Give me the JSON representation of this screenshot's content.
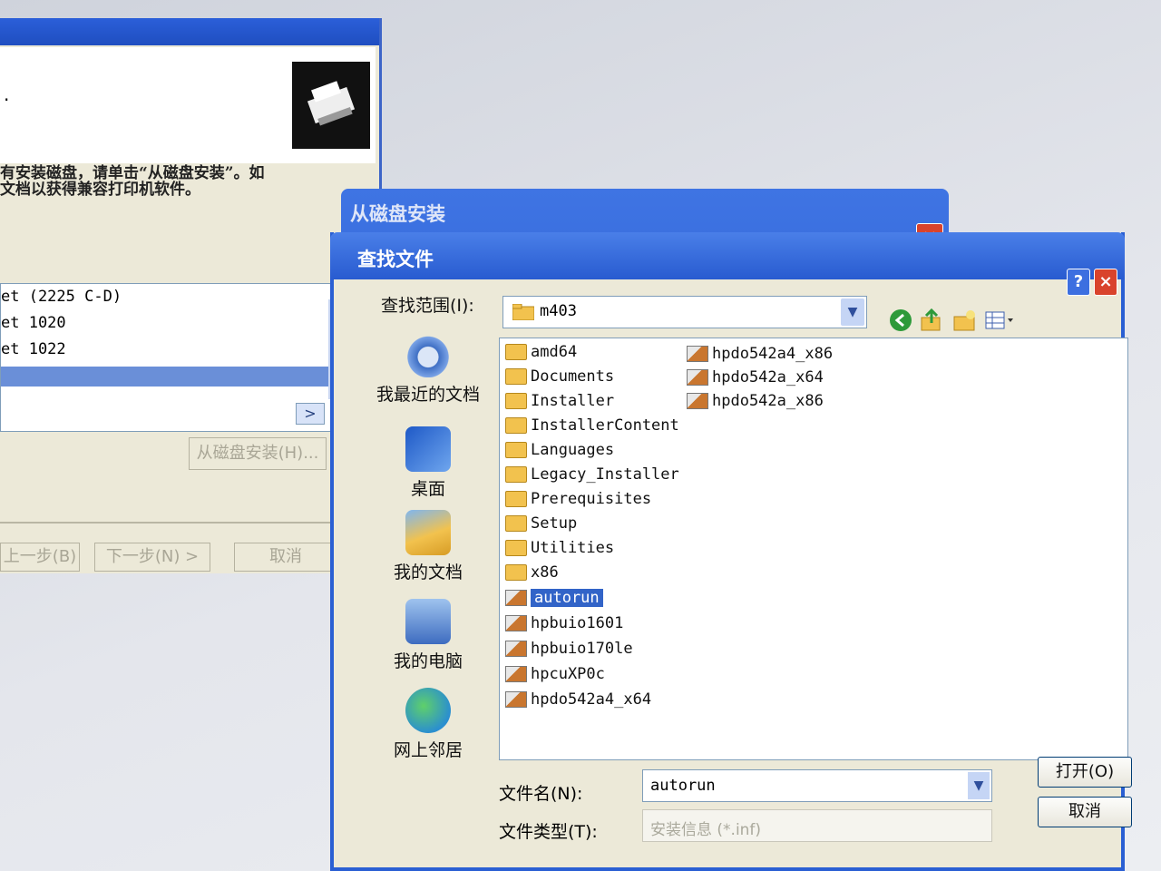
{
  "background_wizard": {
    "info_line1": "有安装磁盘，请单击“从磁盘安装”。如",
    "info_line2": "文档以获得兼容打印机软件。",
    "printers": [
      "et (2225 C-D)",
      "et 1020",
      "et 1022"
    ],
    "have_disk_button": "从磁盘安装(H)...",
    "back_button": "上一步(B)",
    "next_button": "下一步(N) >",
    "cancel_button": "取消"
  },
  "install_from_disk_dialog": {
    "title": "从磁盘安装",
    "close": "×"
  },
  "find_file_dialog": {
    "title": "查找文件",
    "help": "?",
    "close": "×",
    "look_in_label": "查找范围(I):",
    "look_in_value": "m403",
    "places": [
      {
        "label": "我最近的文档",
        "icon": "recent-documents-icon"
      },
      {
        "label": "桌面",
        "icon": "desktop-icon"
      },
      {
        "label": "我的文档",
        "icon": "my-documents-icon"
      },
      {
        "label": "我的电脑",
        "icon": "my-computer-icon"
      },
      {
        "label": "网上邻居",
        "icon": "network-places-icon"
      }
    ],
    "files": [
      {
        "name": "amd64",
        "type": "folder"
      },
      {
        "name": "Documents",
        "type": "folder"
      },
      {
        "name": "Installer",
        "type": "folder"
      },
      {
        "name": "InstallerContent",
        "type": "folder"
      },
      {
        "name": "Languages",
        "type": "folder"
      },
      {
        "name": "Legacy_Installer",
        "type": "folder"
      },
      {
        "name": "Prerequisites",
        "type": "folder"
      },
      {
        "name": "Setup",
        "type": "folder"
      },
      {
        "name": "Utilities",
        "type": "folder"
      },
      {
        "name": "x86",
        "type": "folder"
      },
      {
        "name": "autorun",
        "type": "setup",
        "selected": true
      },
      {
        "name": "hpbuio1601",
        "type": "setup"
      },
      {
        "name": "hpbuio170le",
        "type": "setup"
      },
      {
        "name": "hpcuXP0c",
        "type": "setup"
      },
      {
        "name": "hpdo542a4_x64",
        "type": "setup"
      },
      {
        "name": "hpdo542a4_x86",
        "type": "setup"
      },
      {
        "name": "hpdo542a_x64",
        "type": "setup"
      },
      {
        "name": "hpdo542a_x86",
        "type": "setup"
      }
    ],
    "file_name_label": "文件名(N):",
    "file_name_value": "autorun",
    "file_type_label": "文件类型(T):",
    "file_type_value": "安装信息 (*.inf)",
    "open_button": "打开(O)",
    "cancel_button": "取消",
    "colors": {
      "title_bar": "#285bd0",
      "selection": "#3264c8",
      "folder": "#f2c24e",
      "close": "#d9432c"
    }
  }
}
